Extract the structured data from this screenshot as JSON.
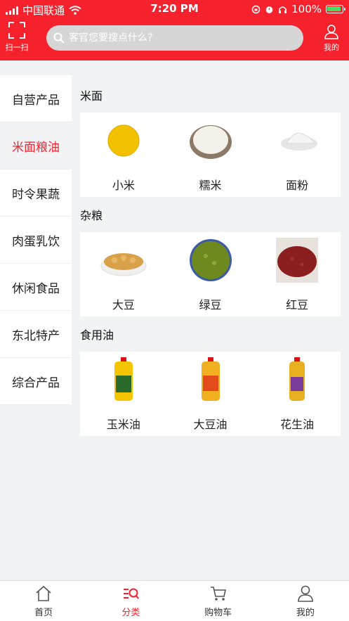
{
  "status_bar": {
    "carrier": "中国联通",
    "time": "7:20 PM",
    "battery": "100%"
  },
  "header": {
    "scan_label": "扫一扫",
    "search_placeholder": "客官您要搜点什么?",
    "me_label": "我的"
  },
  "categories": [
    "自营产品",
    "米面粮油",
    "时令果蔬",
    "肉蛋乳饮",
    "休闲食品",
    "东北特产",
    "综合产品"
  ],
  "active_category": "米面粮油",
  "sections": [
    {
      "title": "米面",
      "items": [
        "小米",
        "糯米",
        "面粉"
      ]
    },
    {
      "title": "杂粮",
      "items": [
        "大豆",
        "绿豆",
        "红豆"
      ]
    },
    {
      "title": "食用油",
      "items": [
        "玉米油",
        "大豆油",
        "花生油"
      ]
    }
  ],
  "tabbar": [
    "首页",
    "分类",
    "购物车",
    "我的"
  ],
  "colors": {
    "brand_red": "#f5222d",
    "page_bg": "#f2f3f5"
  }
}
